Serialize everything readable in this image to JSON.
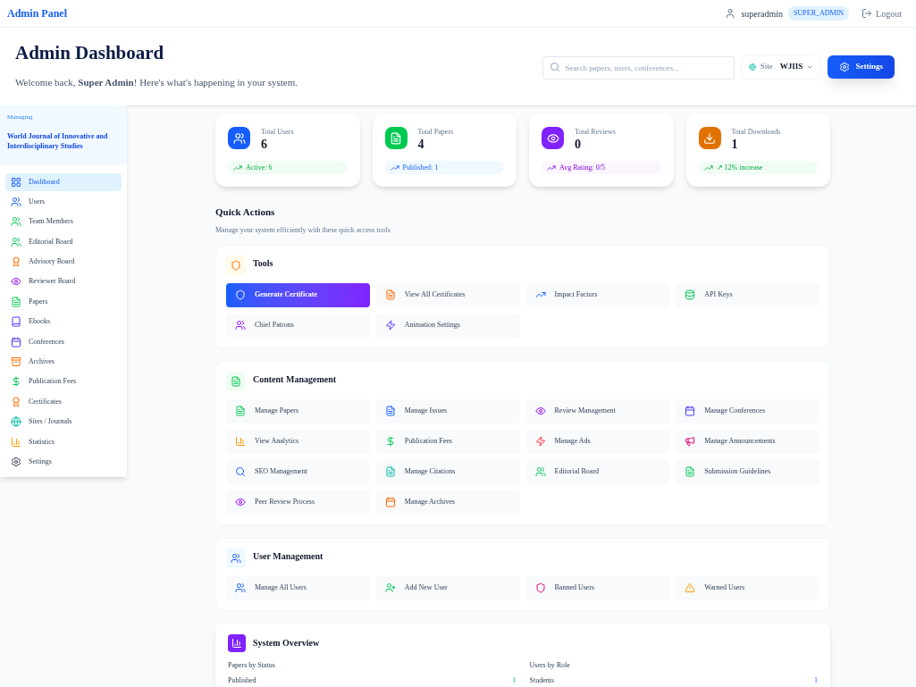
{
  "top_bar": {
    "brand": "Admin Panel",
    "username": "superadmin",
    "role_badge": "SUPER_ADMIN",
    "logout": "Logout"
  },
  "header": {
    "title": "Admin Dashboard",
    "welcome": "Welcome back, **Super Admin**! Here's what's happening in your system.",
    "search": {
      "placeholder": "Search papers, users, conferences..."
    },
    "site_selector": {
      "label": "Site",
      "value": "WJIIS"
    },
    "settings_button": "Settings"
  },
  "sidebar": {
    "managing_label": "Managing",
    "journal": "World Journal of Innovative and Interdisciplinary Studies",
    "items": [
      {
        "label": "Dashboard",
        "selected": true
      },
      {
        "label": "Users",
        "selected": false
      },
      {
        "label": "Team Members",
        "selected": false
      },
      {
        "label": "Editorial Board",
        "selected": false
      },
      {
        "label": "Advisory Board",
        "selected": false
      },
      {
        "label": "Reviewer Board",
        "selected": false
      },
      {
        "label": "Papers",
        "selected": false
      },
      {
        "label": "Ebooks",
        "selected": false
      },
      {
        "label": "Conferences",
        "selected": false
      },
      {
        "label": "Archives",
        "selected": false
      },
      {
        "label": "Publication Fees",
        "selected": false
      },
      {
        "label": "Certificates",
        "selected": false
      },
      {
        "label": "Sites / Journals",
        "selected": false
      },
      {
        "label": "Statistics",
        "selected": false
      },
      {
        "label": "Settings",
        "selected": false
      }
    ]
  },
  "stats": [
    {
      "label": "Total Users",
      "value": "6",
      "note": "Active: 6"
    },
    {
      "label": "Total Papers",
      "value": "4",
      "note": "Published: 1"
    },
    {
      "label": "Total Reviews",
      "value": "0",
      "note": "Avg Rating: 0/5"
    },
    {
      "label": "Total Downloads",
      "value": "1",
      "note": "↗ 12% increase"
    }
  ],
  "quick_actions": {
    "title": "Quick Actions",
    "subtitle": "Manage your system efficiently with these quick access tools"
  },
  "sections": [
    {
      "title": "Tools",
      "actions": [
        {
          "label": "Generate Certificate",
          "selected": true
        },
        {
          "label": "View All Certificates",
          "selected": false
        },
        {
          "label": "Impact Factors",
          "selected": false
        },
        {
          "label": "API Keys",
          "selected": false
        },
        {
          "label": "Chief Patrons",
          "selected": false
        },
        {
          "label": "Animation Settings",
          "selected": false
        }
      ]
    },
    {
      "title": "Content Management",
      "actions": [
        {
          "label": "Manage Papers",
          "selected": false
        },
        {
          "label": "Manage Issues",
          "selected": false
        },
        {
          "label": "Review Management",
          "selected": false
        },
        {
          "label": "Manage Conferences",
          "selected": false
        },
        {
          "label": "View Analytics",
          "selected": false
        },
        {
          "label": "Publication Fees",
          "selected": false
        },
        {
          "label": "Manage Ads",
          "selected": false
        },
        {
          "label": "Manage Announcements",
          "selected": false
        },
        {
          "label": "SEO Management",
          "selected": false
        },
        {
          "label": "Manage Citations",
          "selected": false
        },
        {
          "label": "Editorial Board",
          "selected": false
        },
        {
          "label": "Submission Guidelines",
          "selected": false
        },
        {
          "label": "Peer Review Process",
          "selected": false
        },
        {
          "label": "Manage Archives",
          "selected": false
        }
      ]
    },
    {
      "title": "User Management",
      "actions": [
        {
          "label": "Manage All Users",
          "selected": false
        },
        {
          "label": "Add New User",
          "selected": false
        },
        {
          "label": "Banned Users",
          "selected": false
        },
        {
          "label": "Warned Users",
          "selected": false
        }
      ]
    }
  ],
  "system_overview": {
    "title": "System Overview",
    "columns": [
      {
        "heading": "Papers by Status",
        "rows": [
          {
            "label": "Published",
            "value": "1"
          }
        ]
      },
      {
        "heading": "Users by Role",
        "rows": [
          {
            "label": "Students",
            "value": "1"
          }
        ]
      }
    ]
  }
}
